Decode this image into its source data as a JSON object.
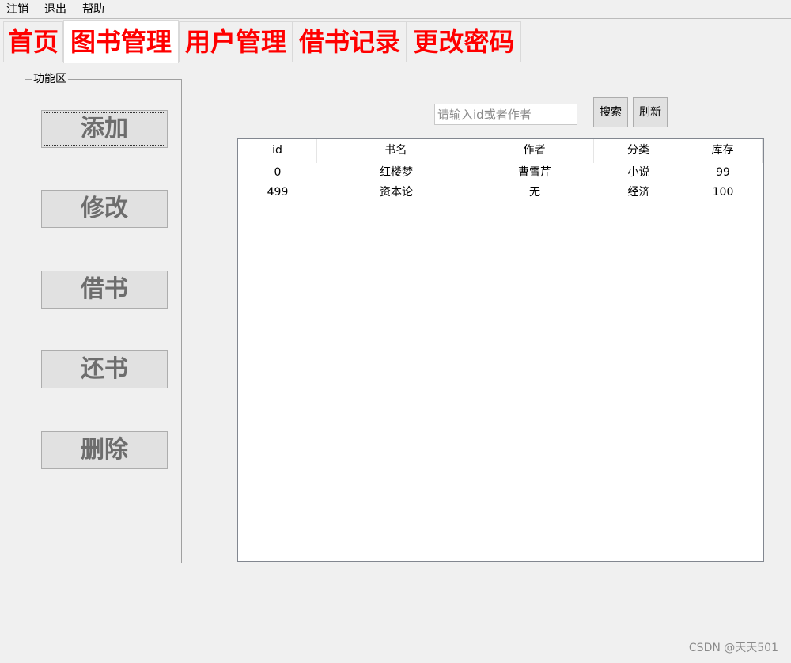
{
  "menu": {
    "logout": "注销",
    "exit": "退出",
    "help": "帮助"
  },
  "tabs": [
    {
      "label": "首页"
    },
    {
      "label": "图书管理"
    },
    {
      "label": "用户管理"
    },
    {
      "label": "借书记录"
    },
    {
      "label": "更改密码"
    }
  ],
  "active_tab": "图书管理",
  "function_area": {
    "title": "功能区",
    "buttons": [
      {
        "label": "添加"
      },
      {
        "label": "修改"
      },
      {
        "label": "借书"
      },
      {
        "label": "还书"
      },
      {
        "label": "删除"
      }
    ]
  },
  "search": {
    "placeholder": "请输入id或者作者",
    "value": "",
    "search_label": "搜索",
    "refresh_label": "刷新"
  },
  "table": {
    "columns": [
      "id",
      "书名",
      "作者",
      "分类",
      "库存"
    ],
    "rows": [
      [
        "0",
        "红楼梦",
        "曹雪芹",
        "小说",
        "99"
      ],
      [
        "499",
        "资本论",
        "无",
        "经济",
        "100"
      ]
    ]
  },
  "watermark": "CSDN @天天501",
  "colors": {
    "tab_text": "#ff0000",
    "window_bg": "#f0f0f0",
    "button_face": "#e1e1e1",
    "disabled_text": "#6d6d6d"
  }
}
